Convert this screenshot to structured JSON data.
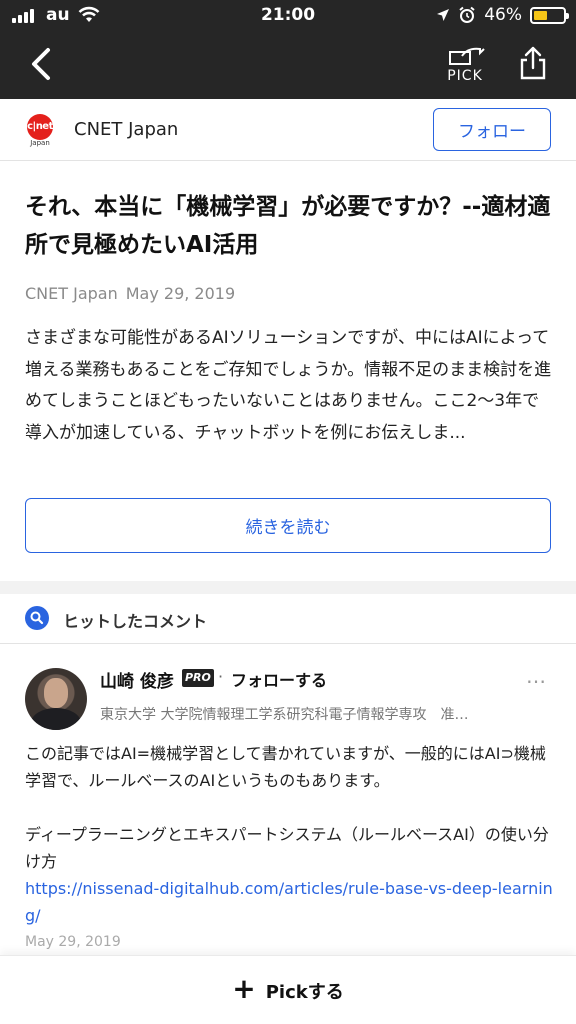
{
  "status_bar": {
    "carrier": "au",
    "time": "21:00",
    "battery": "46%",
    "battery_level": 0.46
  },
  "nav": {
    "pick_label": "PICK"
  },
  "source": {
    "logo_text": "c|net",
    "logo_sub": "Japan",
    "name": "CNET Japan",
    "follow_label": "フォロー"
  },
  "article": {
    "title": "それ、本当に「機械学習」が必要ですか？--適材適所で見極めたいAI活用",
    "source": "CNET Japan",
    "date": "May 29, 2019",
    "summary": "さまざまな可能性があるAIソリューションですが、中にはAIによって増える業務もあることをご存知でしょうか。情報不足のまま検討を進めてしまうことほどもったいないことはありません。ここ2〜3年で導入が加速している、チャットボットを例にお伝えしま...",
    "read_more_label": "続きを読む"
  },
  "hit_comments": {
    "label": "ヒットしたコメント"
  },
  "comment": {
    "author": "山崎 俊彦",
    "badge": "PRO",
    "separator": "·",
    "follow_label": "フォローする",
    "affiliation": "東京大学 大学院情報理工学系研究科電子情報学専攻　准…",
    "body_line1": "この記事ではAI=機械学習として書かれていますが、一般的にはAI⊃機械学習で、ルールベースのAIというものもあります。",
    "body_line2": "ディープラーニングとエキスパートシステム（ルールベースAI）の使い分け方",
    "link": "https://nissenad-digitalhub.com/articles/rule-base-vs-deep-learning/",
    "date": "May 29, 2019",
    "more_icon": "…"
  },
  "bottom_bar": {
    "plus": "+",
    "pick_label": "Pickする"
  }
}
